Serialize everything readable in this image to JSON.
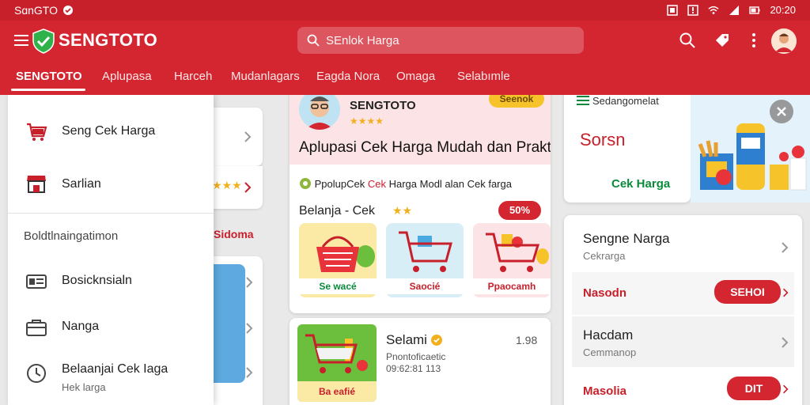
{
  "status_bar": {
    "brand": "SɑnGTO",
    "time": "20:20"
  },
  "app_bar": {
    "brand": "SENGTOTO",
    "search": {
      "placeholder": "SEnlok Harga"
    },
    "tabs": [
      {
        "label": "SENGTOTO",
        "active": true
      },
      {
        "label": "Aplupasa",
        "active": false
      },
      {
        "label": "Harceh",
        "active": false
      },
      {
        "label": "Mudanlagars",
        "active": false
      },
      {
        "label": "Eagda Nora",
        "active": false
      },
      {
        "label": "Omaga",
        "active": false
      },
      {
        "label": "Selabımle",
        "active": false
      }
    ],
    "actions": [
      "search-icon",
      "tag-icon",
      "more-vertical-icon",
      "profile-avatar"
    ]
  },
  "drawer": {
    "items": [
      {
        "label": "Seng Cek Harga",
        "icon": "cart-icon"
      },
      {
        "label": "Sarlian",
        "icon": "store-icon"
      },
      {
        "label": "Bosicknsialn",
        "icon": "card-icon"
      },
      {
        "label": "Nanga",
        "icon": "wallet-icon"
      },
      {
        "label": "Belaanjai Cek Iaga",
        "sub": "Hek larga",
        "icon": "clock-icon"
      }
    ],
    "section_header": "Boldtlnaingatimon"
  },
  "background_left": {
    "stars": "★★★",
    "link": "Sidoma"
  },
  "hero_card": {
    "name": "SENGTOTO",
    "stars": "★★★★",
    "badge": "Seenok",
    "title": "Aplupasi Cek Harga Mudah dan Praktis",
    "subtitle_prefix": "PpolupCek",
    "subtitle_red": "Cek",
    "subtitle_rest": "Harga Modl alan Cek farga",
    "shop_label": "Belanja - Cek",
    "shop_stars": "★★",
    "discount": "50%",
    "tiles": [
      {
        "label": "Se wacé",
        "color": "#0a8a3a"
      },
      {
        "label": "Saocié",
        "color": "#c8202b"
      },
      {
        "label": "Ppaocamh",
        "color": "#c8202b"
      }
    ]
  },
  "store_card": {
    "name": "Selami",
    "rating": "1.98",
    "address_line1": "Pnontoficaetic",
    "address_line2": "09:62:81 113",
    "tile_label": "Ba eafié"
  },
  "promo_card": {
    "header": "Sedangomelat",
    "price": "Sorsn",
    "cta": "Cek Harga"
  },
  "right_list": {
    "rows": [
      {
        "title": "Sengne Narga",
        "sub": "Cekrarga"
      },
      {
        "link": "Nasodn",
        "button": "SEHOI"
      },
      {
        "title": "Hacdam",
        "sub": "Cemmanop"
      },
      {
        "link": "Masolia",
        "button": "DIT"
      }
    ]
  },
  "colors": {
    "primary": "#d42631",
    "tab_active": "#ffffff",
    "accent_green": "#0a8a3a"
  }
}
